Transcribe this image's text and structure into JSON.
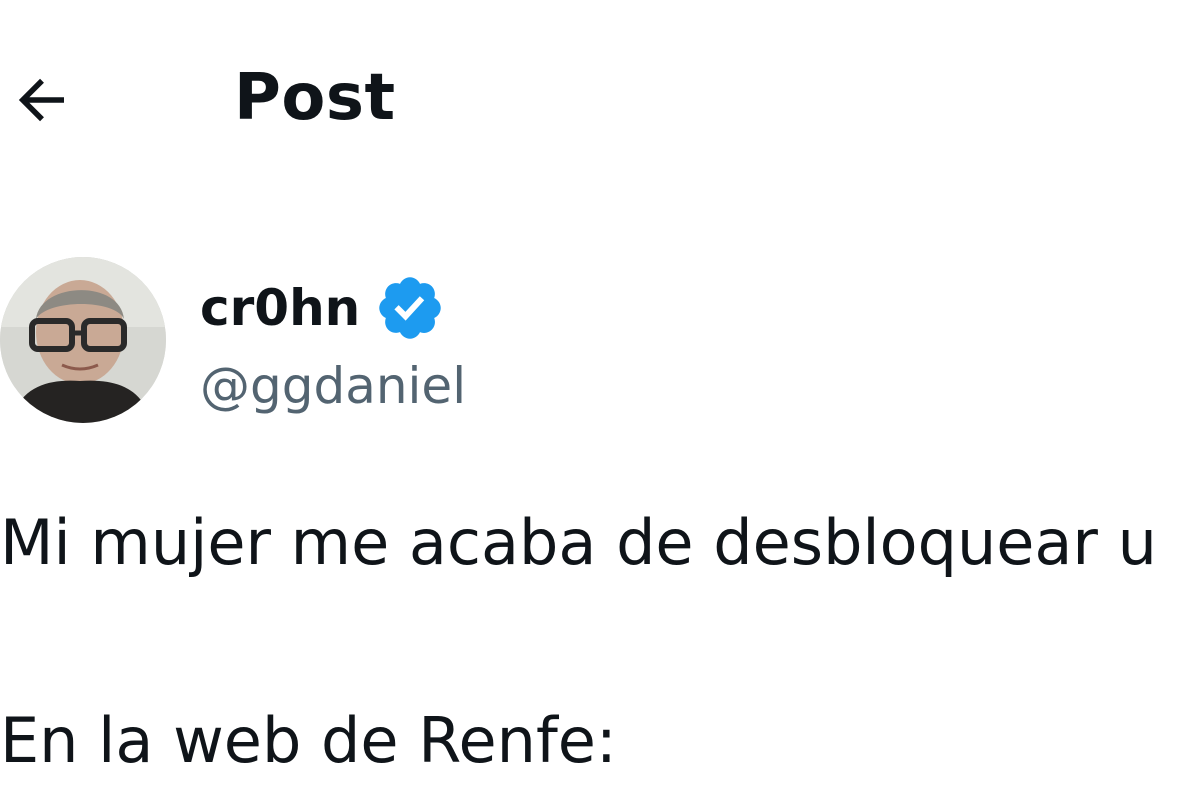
{
  "header": {
    "back_icon": "arrow-left-icon",
    "title": "Post"
  },
  "author": {
    "display_name": "cr0hn",
    "verified_icon": "verified-badge-icon",
    "verified_color": "#1d9bf0",
    "handle": "@ggdaniel"
  },
  "tweet": {
    "lines": [
      "Mi mujer me acaba de desbloquear u",
      "En la web de Renfe:"
    ]
  },
  "colors": {
    "text_primary": "#0f1419",
    "text_secondary": "#536471",
    "background": "#ffffff"
  }
}
